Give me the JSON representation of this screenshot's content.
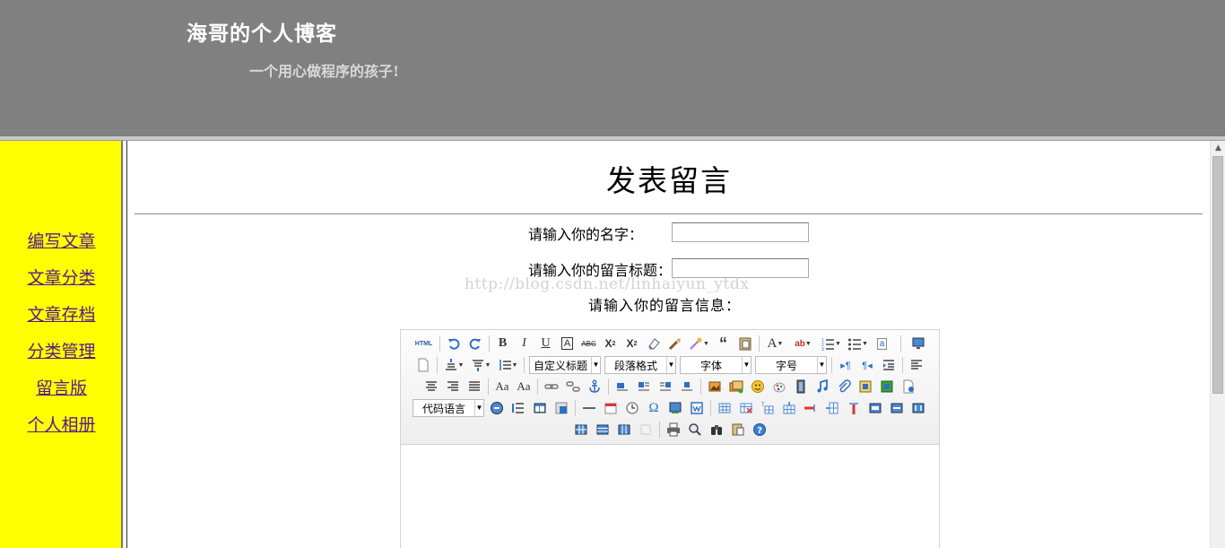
{
  "header": {
    "site_title": "海哥的个人博客",
    "site_subtitle": "一个用心做程序的孩子!"
  },
  "sidebar": {
    "items": [
      {
        "label": "编写文章"
      },
      {
        "label": "文章分类"
      },
      {
        "label": "文章存档"
      },
      {
        "label": "分类管理"
      },
      {
        "label": "留言版"
      },
      {
        "label": "个人相册"
      }
    ]
  },
  "main": {
    "page_title": "发表留言",
    "name_label": "请输入你的名字：",
    "name_value": "",
    "subject_label": "请输入你的留言标题：",
    "subject_value": "",
    "message_label": "请输入你的留言信息：",
    "watermark": "http://blog.csdn.net/linhaiyun_ytdx"
  },
  "editor": {
    "custom_heading": "自定义标题",
    "paragraph_format": "段落格式",
    "font_family": "字体",
    "font_size": "字号",
    "code_language": "代码语言",
    "html_label": "HTML"
  },
  "colors": {
    "header_bg": "#808080",
    "sidebar_bg": "#ffff00",
    "link": "#551a8b"
  }
}
